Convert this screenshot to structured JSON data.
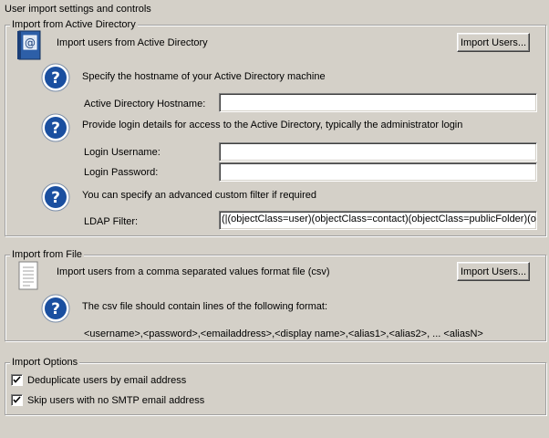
{
  "page": {
    "heading": "User import settings and controls"
  },
  "active_directory": {
    "legend": "Import from Active Directory",
    "import_label": "Import users from Active Directory",
    "import_button": "Import Users...",
    "hostname_help": "Specify the hostname of your Active Directory machine",
    "hostname_label": "Active Directory Hostname:",
    "hostname_value": "",
    "login_help": "Provide login details for access to the Active Directory, typically the administrator login",
    "username_label": "Login Username:",
    "username_value": "",
    "password_label": "Login Password:",
    "password_value": "",
    "filter_help": "You can specify an advanced custom filter if required",
    "filter_label": "LDAP Filter:",
    "filter_value": "(|(objectClass=user)(objectClass=contact)(objectClass=publicFolder)(objectClass=group))"
  },
  "file_import": {
    "legend": "Import from File",
    "import_label": "Import users from a comma separated values format file (csv)",
    "import_button": "Import Users...",
    "format_help": "The csv file should contain lines of the following format:",
    "format_example": "<username>,<password>,<emailaddress>,<display name>,<alias1>,<alias2>, ... <aliasN>"
  },
  "options": {
    "legend": "Import Options",
    "dedupe_label": "Deduplicate users by email address",
    "dedupe_checked": true,
    "skip_label": "Skip users with no SMTP email address",
    "skip_checked": true
  },
  "icons": {
    "ad_book": "address-book-icon",
    "help": "help-question-icon",
    "document": "document-icon",
    "check": "check-mark-icon"
  },
  "colors": {
    "window_bg": "#d4d0c8",
    "help_blue": "#1a4fa0",
    "book_blue": "#2d5fa8"
  }
}
